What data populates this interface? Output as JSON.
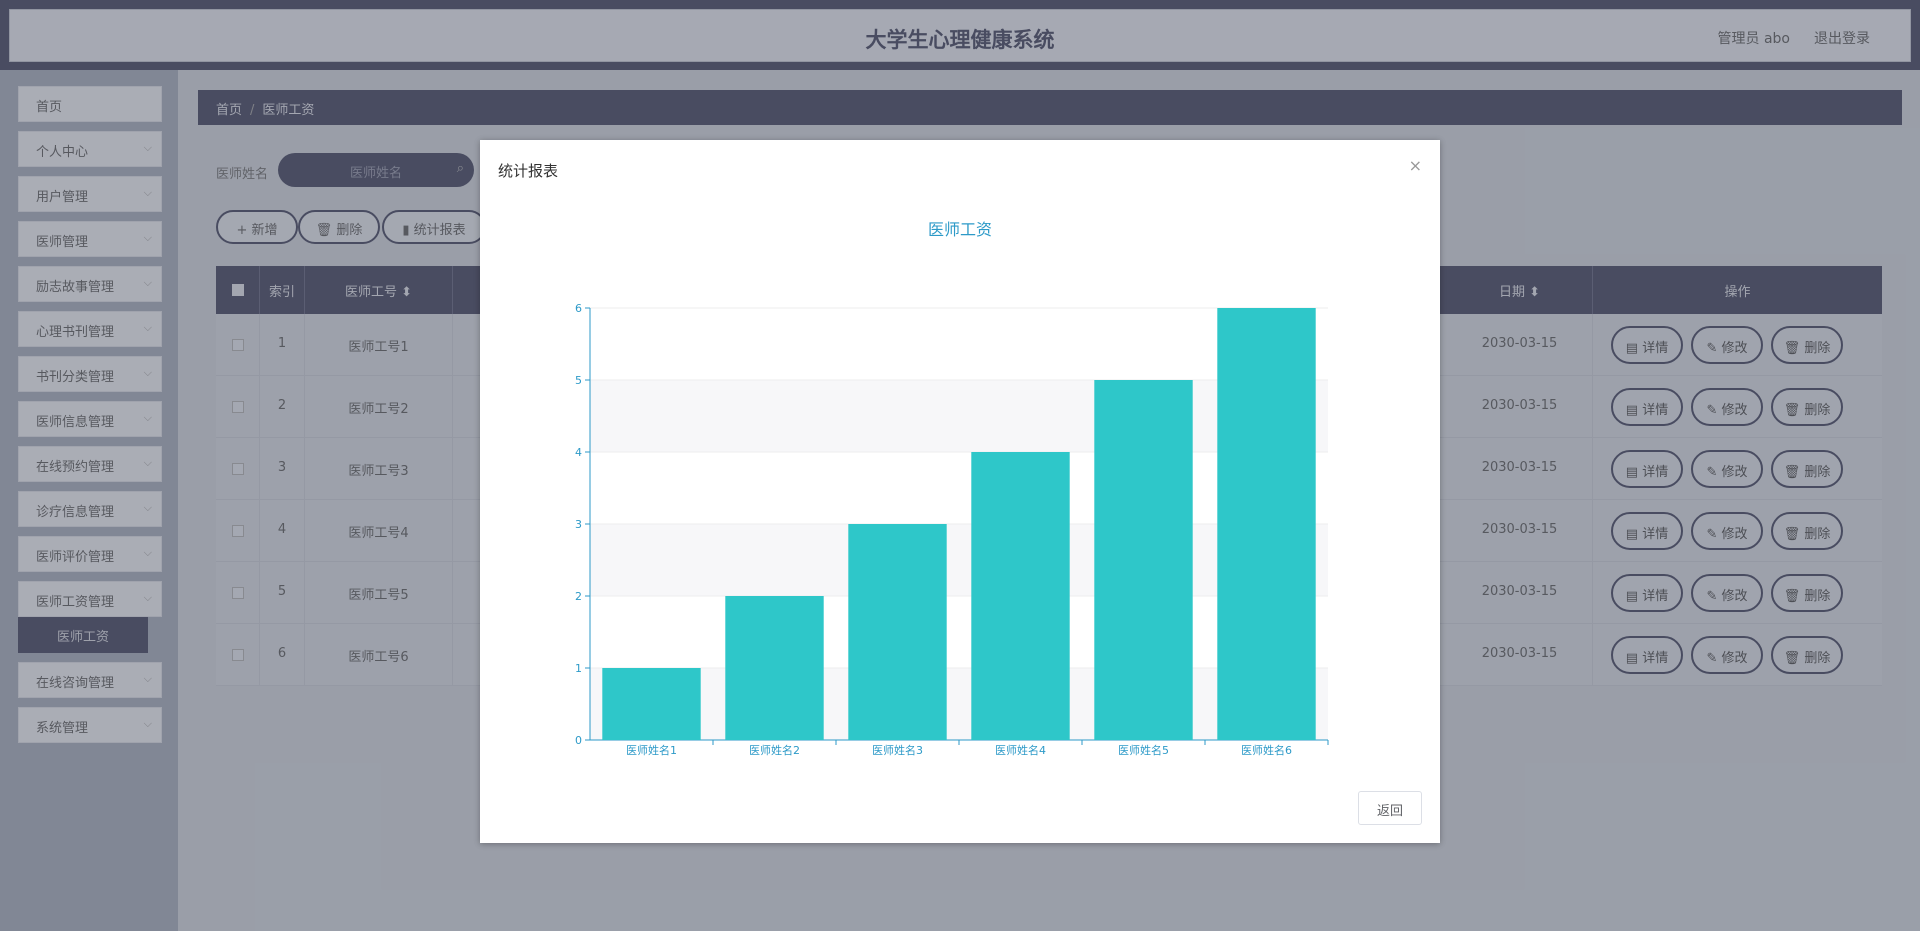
{
  "header": {
    "app_title": "大学生心理健康系统",
    "admin_label": "管理员 abo",
    "logout_label": "退出登录"
  },
  "sidebar": {
    "items": [
      {
        "label": "首页",
        "has_chevron": false
      },
      {
        "label": "个人中心",
        "has_chevron": true
      },
      {
        "label": "用户管理",
        "has_chevron": true
      },
      {
        "label": "医师管理",
        "has_chevron": true
      },
      {
        "label": "励志故事管理",
        "has_chevron": true
      },
      {
        "label": "心理书刊管理",
        "has_chevron": true
      },
      {
        "label": "书刊分类管理",
        "has_chevron": true
      },
      {
        "label": "医师信息管理",
        "has_chevron": true
      },
      {
        "label": "在线预约管理",
        "has_chevron": true
      },
      {
        "label": "诊疗信息管理",
        "has_chevron": true
      },
      {
        "label": "医师评价管理",
        "has_chevron": true
      },
      {
        "label": "医师工资管理",
        "has_chevron": true
      },
      {
        "label": "在线咨询管理",
        "has_chevron": true
      },
      {
        "label": "系统管理",
        "has_chevron": true
      }
    ],
    "active_sub_item": "医师工资"
  },
  "breadcrumb": {
    "home": "首页",
    "separator": "/",
    "current": "医师工资"
  },
  "search": {
    "label": "医师姓名",
    "placeholder": "医师姓名"
  },
  "toolbar": {
    "add_label": "+ 新增",
    "delete_label": "删除",
    "stats_label": "统计报表"
  },
  "table": {
    "headers": {
      "index": "索引",
      "doctor_no": "医师工号 ⬍",
      "date": "日期 ⬍",
      "actions": "操作"
    },
    "rows": [
      {
        "index": "1",
        "doctor_no": "医师工号1",
        "date": "2030-03-15"
      },
      {
        "index": "2",
        "doctor_no": "医师工号2",
        "date": "2030-03-15"
      },
      {
        "index": "3",
        "doctor_no": "医师工号3",
        "date": "2030-03-15"
      },
      {
        "index": "4",
        "doctor_no": "医师工号4",
        "date": "2030-03-15"
      },
      {
        "index": "5",
        "doctor_no": "医师工号5",
        "date": "2030-03-15"
      },
      {
        "index": "6",
        "doctor_no": "医师工号6",
        "date": "2030-03-15"
      }
    ],
    "action_labels": {
      "detail": "详情",
      "edit": "修改",
      "delete": "删除"
    }
  },
  "dialog": {
    "title": "统计报表",
    "close_glyph": "×",
    "back_label": "返回"
  },
  "chart_data": {
    "type": "bar",
    "title": "医师工资",
    "categories": [
      "医师姓名1",
      "医师姓名2",
      "医师姓名3",
      "医师姓名4",
      "医师姓名5",
      "医师姓名6"
    ],
    "values": [
      1,
      2,
      3,
      4,
      5,
      6
    ],
    "ylim": [
      0,
      6
    ],
    "yticks": [
      0,
      1,
      2,
      3,
      4,
      5,
      6
    ],
    "xlabel": "",
    "ylabel": "",
    "grid": true,
    "bar_color": "#2ec7c9",
    "axis_color": "#2d9ac8"
  },
  "colors": {
    "primary_dark": "#3d3f58",
    "chart_accent": "#2d9ac8",
    "bar": "#2ec7c9"
  }
}
